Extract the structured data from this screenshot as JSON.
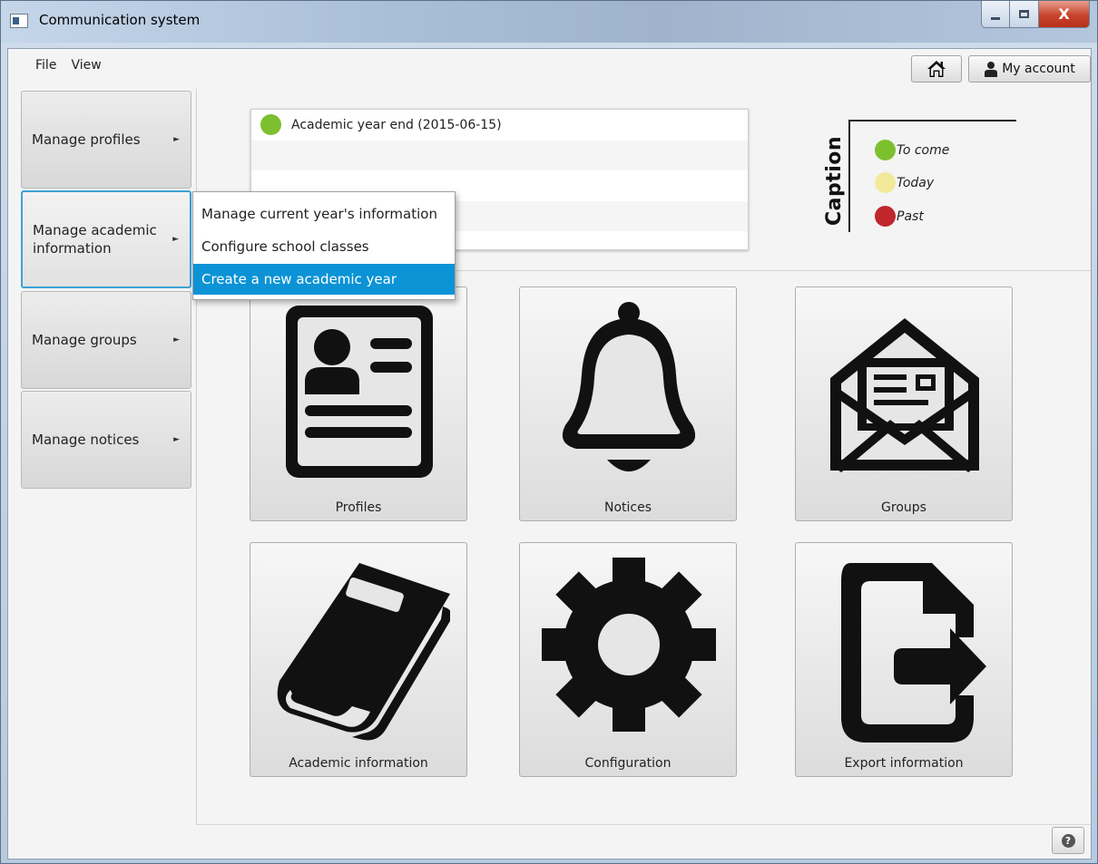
{
  "window": {
    "title": "Communication system",
    "close_glyph": "X"
  },
  "menubar": {
    "items": [
      "File",
      "View"
    ]
  },
  "toolbar": {
    "account_label": "My account"
  },
  "sidebar": {
    "items": [
      {
        "label": "Manage profiles"
      },
      {
        "label": "Manage academic information"
      },
      {
        "label": "Manage groups"
      },
      {
        "label": "Manage notices"
      }
    ]
  },
  "submenu": {
    "items": [
      "Manage current year's information",
      "Configure school classes",
      "Create a new academic year"
    ],
    "selected": "Create a new academic year"
  },
  "timeline": {
    "events": [
      {
        "text": "Academic year end (2015-06-15)",
        "status": "To come",
        "color": "#7dc02f"
      }
    ]
  },
  "caption": {
    "title": "Caption",
    "items": [
      {
        "label": "To come",
        "color": "#7dc02f"
      },
      {
        "label": "Today",
        "color": "#f3e99a"
      },
      {
        "label": "Past",
        "color": "#c0272c"
      }
    ]
  },
  "tiles": [
    {
      "label": "Profiles",
      "icon": "profile-card-icon"
    },
    {
      "label": "Notices",
      "icon": "bell-icon"
    },
    {
      "label": "Groups",
      "icon": "envelope-icon"
    },
    {
      "label": "Academic information",
      "icon": "book-icon"
    },
    {
      "label": "Configuration",
      "icon": "gear-icon"
    },
    {
      "label": "Export information",
      "icon": "export-file-icon"
    }
  ],
  "help": {
    "glyph": "?"
  },
  "colors": {
    "accent": "#0b93d5",
    "active_border": "#3da2d6"
  }
}
